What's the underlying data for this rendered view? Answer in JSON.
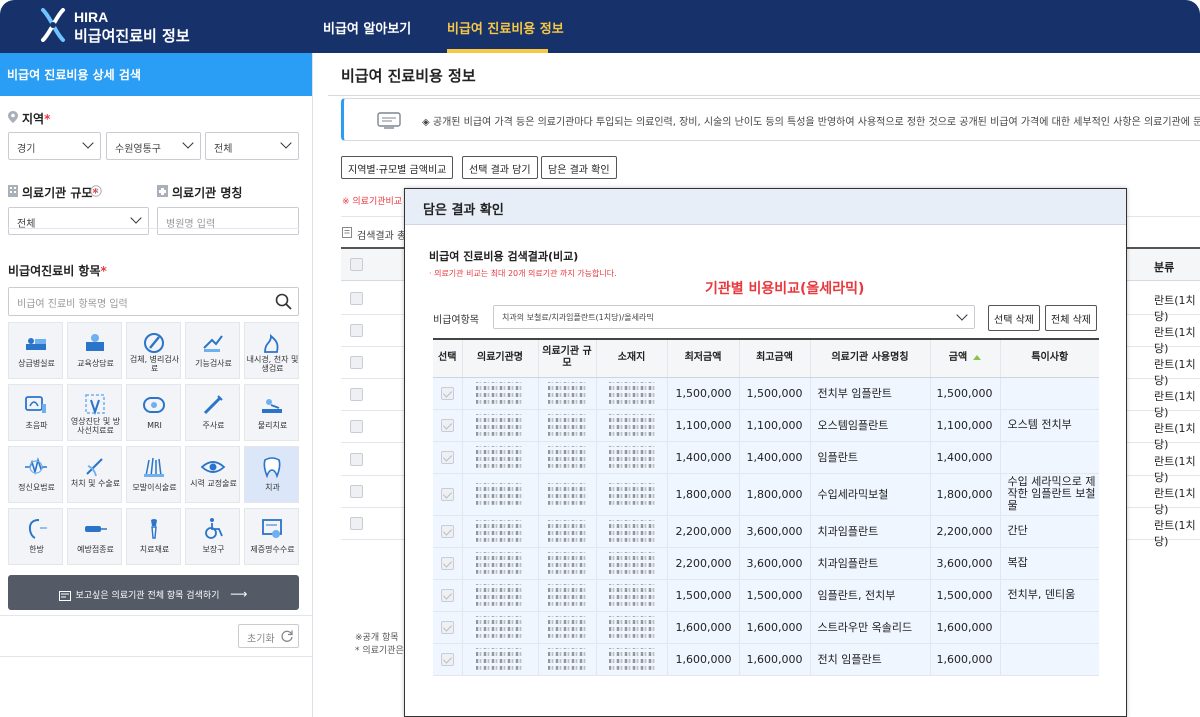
{
  "header": {
    "logo_en": "HIRA",
    "logo_ko": "비급여진료비 정보",
    "nav": [
      {
        "label": "비급여 알아보기",
        "active": false
      },
      {
        "label": "비급여 진료비용 정보",
        "active": true
      }
    ],
    "colors": {
      "nav_bg": "#17326b",
      "active": "#f7c844",
      "accent": "#2a9df4"
    }
  },
  "sidebar": {
    "title": "비급여 진료비용 상세 검색",
    "region_label": "지역",
    "region": {
      "sido": "경기",
      "sigungu": "수원영통구",
      "dong": "전체"
    },
    "org_scale_label": "의료기관 규모",
    "org_scale_value": "전체",
    "org_name_label": "의료기관 명칭",
    "org_name_placeholder": "병원명 입력",
    "item_label": "비급여진료비 항목",
    "item_placeholder": "비급여 진료비 항목명 입력",
    "categories": [
      {
        "label": "상급병실료",
        "icon": "bed-icon"
      },
      {
        "label": "교육상담료",
        "icon": "consult-icon"
      },
      {
        "label": "검체, 병리검사료",
        "icon": "microscope-icon"
      },
      {
        "label": "기능검사료",
        "icon": "function-test-icon"
      },
      {
        "label": "내시경, 천자 및 생검료",
        "icon": "endoscope-icon"
      },
      {
        "label": "초음파",
        "icon": "ultrasound-icon"
      },
      {
        "label": "영상진단 및 방사선치료료",
        "icon": "xray-icon"
      },
      {
        "label": "MRI",
        "icon": "mri-icon"
      },
      {
        "label": "주사료",
        "icon": "syringe-icon"
      },
      {
        "label": "물리치료",
        "icon": "physio-icon"
      },
      {
        "label": "정신요법료",
        "icon": "brain-wave-icon"
      },
      {
        "label": "처치 및 수술료",
        "icon": "surgery-icon"
      },
      {
        "label": "모발이식술료",
        "icon": "hair-icon"
      },
      {
        "label": "시력 교정술료",
        "icon": "eye-icon"
      },
      {
        "label": "치과",
        "icon": "tooth-icon",
        "selected": true
      },
      {
        "label": "한방",
        "icon": "ear-acupuncture-icon"
      },
      {
        "label": "예방접종료",
        "icon": "vaccine-icon"
      },
      {
        "label": "치료재료",
        "icon": "implant-icon"
      },
      {
        "label": "보장구",
        "icon": "wheelchair-icon"
      },
      {
        "label": "제증명수수료",
        "icon": "certificate-icon"
      }
    ],
    "search_all_button": "보고싶은 의료기관 전체 항목 검색하기",
    "reset_button": "초기화"
  },
  "main": {
    "title": "비급여 진료비용 정보",
    "notice": "◈ 공개된 비급여 가격 등은 의료기관마다 투입되는 의료인력, 장비, 시술의 난이도 등의 특성을 반영하여 사용적으로 정한 것으로 공개된 비급여 가격에 대한 세부적인 사항은 의료기관에 문의하시기 바랍니다.",
    "buttons": [
      "지역별·규모별 금액비교",
      "선택 결과 담기",
      "담은 결과 확인"
    ],
    "red_note": "※ 의료기관비교",
    "result_label": "검색결과 총",
    "col_right": "분류",
    "right_cells": [
      "란트(1치당)",
      "란트(1치당)",
      "란트(1치당)",
      "란트(1치당)",
      "란트(1치당)",
      "란트(1치당)",
      "란트(1치당)",
      "란트(1치당)"
    ],
    "footnote1": "※공개 항목",
    "footnote2": "* 의료기관은"
  },
  "modal": {
    "header": "담은 결과 확인",
    "title": "비급여 진료비용 검색결과(비교)",
    "subtitle": "· 의료기관 비교는 최대 20개 의료기관 까지 가능합니다.",
    "highlight": "기관별 비용비교(올세라믹)",
    "item_label": "비급여항목",
    "item_value": "치과의 보철료/치과임플란트(1치당)/올세라믹",
    "btn_delete_selected": "선택 삭제",
    "btn_delete_all": "전체 삭제",
    "columns": [
      "선택",
      "의료기관명",
      "의료기관 규모",
      "소재지",
      "최저금액",
      "최고금액",
      "의료기관 사용명칭",
      "금액",
      "특이사항"
    ],
    "rows": [
      {
        "min": "1,500,000",
        "max": "1,500,000",
        "name": "전치부 임플란트",
        "price": "1,500,000",
        "note": ""
      },
      {
        "min": "1,100,000",
        "max": "1,100,000",
        "name": "오스템임플란트",
        "price": "1,100,000",
        "note": "오스템 전치부"
      },
      {
        "min": "1,400,000",
        "max": "1,400,000",
        "name": "임플란트",
        "price": "1,400,000",
        "note": ""
      },
      {
        "min": "1,800,000",
        "max": "1,800,000",
        "name": "수입세라믹보철",
        "price": "1,800,000",
        "note": "수입 세라믹으로 제작한 임플란트 보철물"
      },
      {
        "min": "2,200,000",
        "max": "3,600,000",
        "name": "치과임플란트",
        "price": "2,200,000",
        "note": "간단"
      },
      {
        "min": "2,200,000",
        "max": "3,600,000",
        "name": "치과임플란트",
        "price": "3,600,000",
        "note": "복잡"
      },
      {
        "min": "1,500,000",
        "max": "1,500,000",
        "name": "임플란트, 전치부",
        "price": "1,500,000",
        "note": "전치부, 덴티움"
      },
      {
        "min": "1,600,000",
        "max": "1,600,000",
        "name": "스트라우만 옥솔리드",
        "price": "1,600,000",
        "note": ""
      },
      {
        "min": "1,600,000",
        "max": "1,600,000",
        "name": "전치 임플란트",
        "price": "1,600,000",
        "note": ""
      }
    ]
  }
}
